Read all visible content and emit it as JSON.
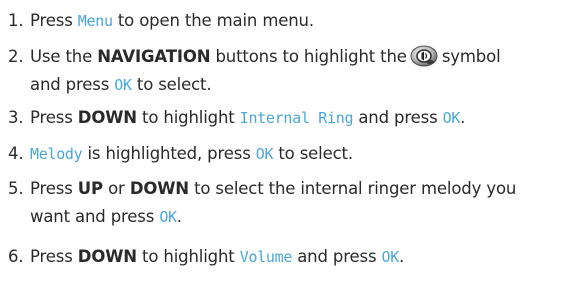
{
  "steps": [
    {
      "number": "1.",
      "parts": [
        "Press",
        "Menu",
        "to open the main menu."
      ]
    },
    {
      "number": "2.",
      "parts": [
        "Use the",
        "NAVIGATION",
        "buttons to highlight the",
        "symbol",
        "and press",
        "OK",
        "to select."
      ],
      "icon": "sound-settings-icon"
    },
    {
      "number": "3.",
      "parts": [
        "Press",
        "DOWN",
        "to highlight",
        "Internal Ring",
        "and press",
        "OK",
        "."
      ]
    },
    {
      "number": "4.",
      "parts": [
        "Melody",
        "is highlighted, press",
        "OK",
        "to select."
      ]
    },
    {
      "number": "5.",
      "parts": [
        "Press",
        "UP",
        "or",
        "DOWN",
        "to select the internal ringer melody you",
        "want and press",
        "OK",
        "."
      ]
    },
    {
      "number": "6.",
      "parts": [
        "Press",
        "DOWN",
        "to highlight",
        "Volume",
        "and press",
        "OK",
        "."
      ]
    }
  ],
  "colors": {
    "text": "#2a2a2a",
    "display_text": "#4aa7d8"
  }
}
